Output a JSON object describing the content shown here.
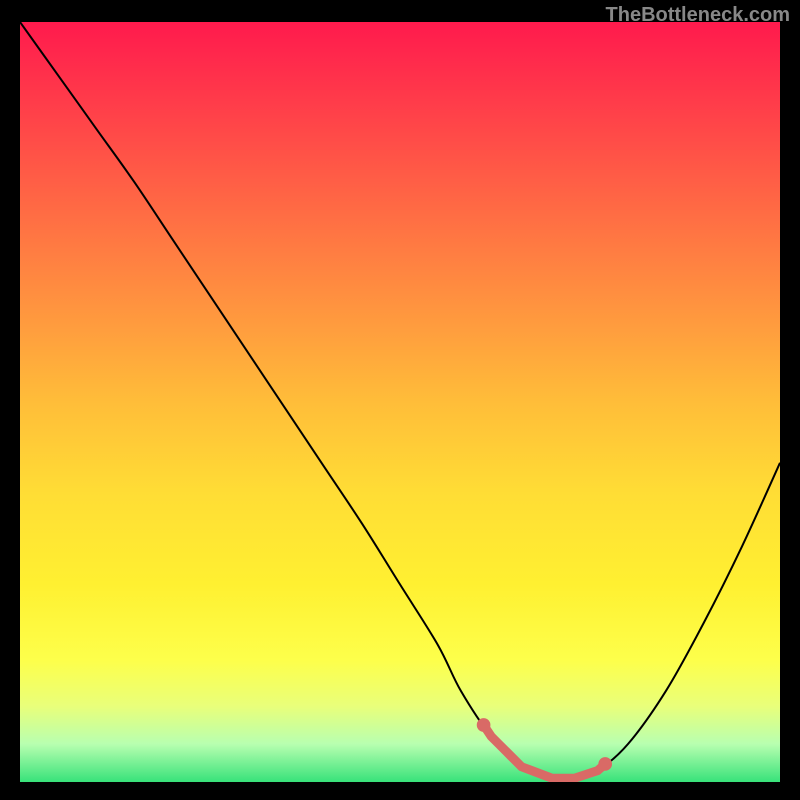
{
  "watermark": "TheBottleneck.com",
  "chart_data": {
    "type": "line",
    "title": "",
    "xlabel": "",
    "ylabel": "",
    "x_range": [
      0,
      100
    ],
    "y_range": [
      0,
      100
    ],
    "series": [
      {
        "name": "bottleneck-curve",
        "x": [
          0,
          5,
          10,
          15,
          20,
          25,
          30,
          35,
          40,
          45,
          50,
          55,
          58,
          62,
          66,
          70,
          73,
          76,
          80,
          85,
          90,
          95,
          100
        ],
        "y": [
          100,
          93,
          86,
          79,
          71.5,
          64,
          56.5,
          49,
          41.5,
          34,
          26,
          18,
          12,
          6,
          2,
          0.5,
          0.5,
          1.5,
          5,
          12,
          21,
          31,
          42
        ],
        "color": "#000000"
      }
    ],
    "highlight": {
      "name": "optimal-zone",
      "x_start": 61,
      "x_end": 77,
      "color": "#d96a66"
    },
    "grid": false,
    "legend": false
  }
}
